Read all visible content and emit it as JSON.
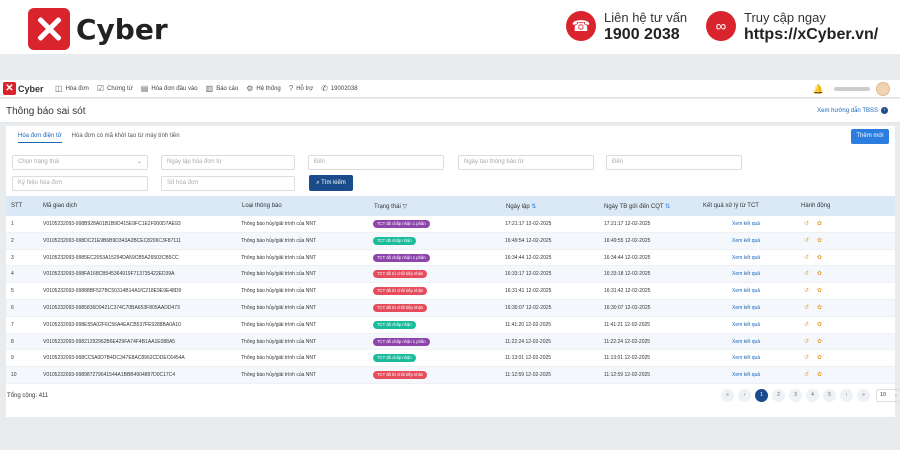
{
  "banner": {
    "brand_name": "Cyber",
    "phone_label": "Liên hệ tư vấn",
    "phone_value": "1900 2038",
    "web_label": "Truy cập ngay",
    "web_value": "https://xCyber.vn/"
  },
  "topnav": {
    "logo_text": "Cyber",
    "items": [
      {
        "label": "Hóa đơn",
        "icon": "box-icon"
      },
      {
        "label": "Chứng từ",
        "icon": "check-doc-icon"
      },
      {
        "label": "Hóa đơn đầu vào",
        "icon": "invoice-in-icon"
      },
      {
        "label": "Báo cáo",
        "icon": "report-icon"
      },
      {
        "label": "Hệ thống",
        "icon": "gear-icon"
      },
      {
        "label": "Hỗ trợ",
        "icon": "help-icon"
      },
      {
        "label": "19002038",
        "icon": "phone-icon"
      }
    ]
  },
  "page": {
    "title": "Thông báo sai sót",
    "guide_link": "Xem hướng dẫn TBSS"
  },
  "tabs": [
    "Hóa đơn điện tử",
    "Hóa đơn có mã khởi tạo từ máy tính tiền"
  ],
  "add_button": "Thêm mới",
  "filters": {
    "status_select": "Chọn trạng thái",
    "invoice_date_from": "Ngày lập hóa đơn từ",
    "invoice_date_to": "Đến",
    "notice_date_from": "Ngày tạo thông báo từ",
    "notice_date_to": "Đến",
    "invoice_symbol": "Ký hiệu hóa đơn",
    "invoice_number": "Số hóa đơn",
    "search_button": "Tìm kiếm"
  },
  "table": {
    "headers": {
      "stt": "STT",
      "code": "Mã giao dịch",
      "type": "Loại thông báo",
      "status": "Trạng thái",
      "created": "Ngày lập",
      "sent": "Ngày TB gửi đến CQT",
      "result": "Kết quả xử lý từ TCT",
      "action": "Hành động"
    },
    "rows": [
      {
        "stt": "1",
        "code": "V0105232093-998B928A01B1B9D415E9FC1E2F000D7AE93",
        "type": "Thông báo hủy/giải trình của NNT",
        "status": "TCT đã chấp nhận 1 phần",
        "status_color": "#8e44ad",
        "created": "17:21:17 12-02-2025",
        "sent": "17:21:17 12-02-2025",
        "result": "Xem kết quả"
      },
      {
        "stt": "2",
        "code": "V0105232093-998DC21E9B6B9D343A2BCEC8206C3F87111",
        "type": "Thông báo hủy/giải trình của NNT",
        "status": "TCT đã chấp nhận",
        "status_color": "#1abc9c",
        "created": "16:49:54 12-02-2025",
        "sent": "16:49:55 12-02-2025",
        "result": "Xem kết quả"
      },
      {
        "stt": "3",
        "code": "V0105232093-9985EC2053A15294DA59CB5A26503CB5CC",
        "type": "Thông báo hủy/giải trình của NNT",
        "status": "TCT đã chấp nhận 1 phần",
        "status_color": "#8e44ad",
        "created": "16:34:44 12-02-2025",
        "sent": "16:34:44 12-02-2025",
        "result": "Xem kết quả"
      },
      {
        "stt": "4",
        "code": "V0105232093-998FA168CB545364919F713735422ED39A",
        "type": "Thông báo hủy/giải trình của NNT",
        "status": "TCT đã từ chối tiếp nhận",
        "status_color": "#e74c5c",
        "created": "16:33:17 12-02-2025",
        "sent": "16:33:18 12-02-2025",
        "result": "Xem kết quả"
      },
      {
        "stt": "5",
        "code": "V0105232093-99888BF527BC50314B14A1fC218E9E9E48D9",
        "type": "Thông báo hủy/giải trình của NNT",
        "status": "TCT đã từ chối tiếp nhận",
        "status_color": "#e74c5c",
        "created": "16:31:41 12-02-2025",
        "sent": "16:31:42 12-02-2025",
        "result": "Xem kết quả"
      },
      {
        "stt": "6",
        "code": "V0105232093-9985836D9421C374C70BA653F805AADD473",
        "type": "Thông báo hủy/giải trình của NNT",
        "status": "TCT đã từ chối tiếp nhận",
        "status_color": "#e74c5c",
        "created": "16:30:07 12-02-2025",
        "sent": "16:30:07 12-02-2025",
        "result": "Xem kết quả"
      },
      {
        "stt": "7",
        "code": "V0105232093-998E55A02F6C56A4EACB537FE9288BA0A10",
        "type": "Thông báo hủy/giải trình của NNT",
        "status": "TCT đã chấp nhận",
        "status_color": "#1abc9c",
        "created": "11:41:20 12-02-2025",
        "sent": "11:41:21 12-02-2025",
        "result": "Xem kết quả"
      },
      {
        "stt": "8",
        "code": "V0105232093-99821292962B6E429FA74F4B1AA1E088A5",
        "type": "Thông báo hủy/giải trình của NNT",
        "status": "TCT đã chấp nhận 1 phần",
        "status_color": "#8e44ad",
        "created": "11:22:24 12-02-2025",
        "sent": "11:22:24 12-02-2025",
        "result": "Xem kết quả"
      },
      {
        "stt": "9",
        "code": "V0105232093-998CC5A0D7B4DC347E8AC8962CDDEC6454A",
        "type": "Thông báo hủy/giải trình của NNT",
        "status": "TCT đã chấp nhận",
        "status_color": "#1abc9c",
        "created": "11:13:01 12-02-2025",
        "sent": "11:13:01 12-02-2025",
        "result": "Xem kết quả"
      },
      {
        "stt": "10",
        "code": "V0105232093-998987279641544A1BBB4904897D0C17C4",
        "type": "Thông báo hủy/giải trình của NNT",
        "status": "TCT đã từ chối tiếp nhận",
        "status_color": "#e74c5c",
        "created": "11:12:59 12-02-2025",
        "sent": "11:12:59 12-02-2025",
        "result": "Xem kết quả"
      }
    ]
  },
  "footer": {
    "total": "Tổng cộng: 411",
    "pages": [
      "«",
      "‹",
      "1",
      "2",
      "3",
      "4",
      "5",
      "›",
      "»"
    ],
    "active_page": "1",
    "page_size": "10"
  },
  "colors": {
    "brand_red": "#d9232d",
    "primary_blue": "#1a4c8b",
    "accent_blue": "#2b7de0",
    "header_bg": "#dbe9f7"
  }
}
